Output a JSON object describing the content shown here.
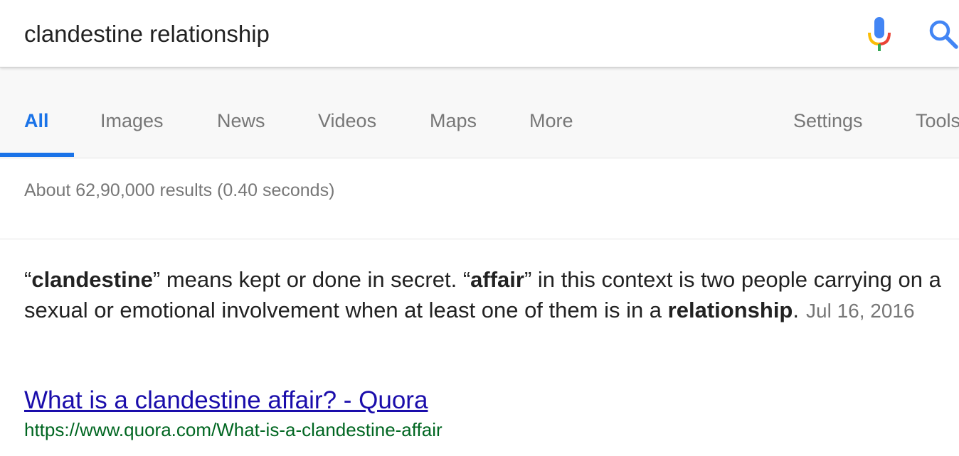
{
  "search": {
    "query": "clandestine relationship"
  },
  "icons": {
    "mic": "microphone-icon",
    "search": "search-icon"
  },
  "colors": {
    "active_tab": "#1a73e8",
    "link": "#1a0dab",
    "url": "#006621",
    "muted": "#777777"
  },
  "tabs": {
    "all": "All",
    "images": "Images",
    "news": "News",
    "videos": "Videos",
    "maps": "Maps",
    "more": "More",
    "settings": "Settings",
    "tools": "Tools"
  },
  "results_stats": "About 62,90,000 results (0.40 seconds)",
  "snippet": {
    "q1_open": "“",
    "term1": "clandestine",
    "part1": "” means kept or done in secret. “",
    "term2": "affair",
    "part2": "” in this context is two people carrying on a sexual or emotional involvement when at least one of them is in a ",
    "term3": "relationship",
    "part3": ".",
    "date": "Jul 16, 2016"
  },
  "result": {
    "title": "What is a clandestine affair? - Quora",
    "url": "https://www.quora.com/What-is-a-clandestine-affair"
  }
}
